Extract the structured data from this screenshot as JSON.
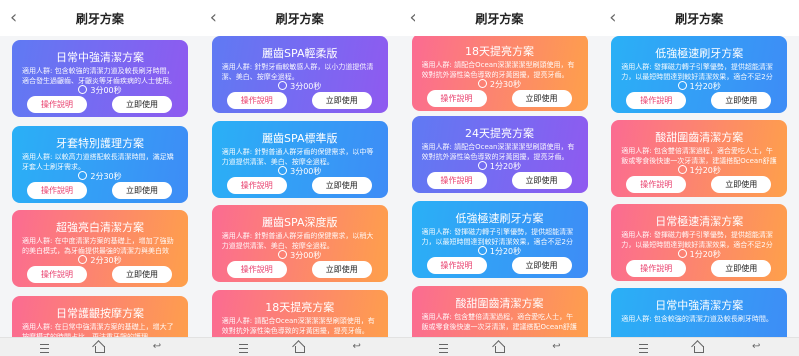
{
  "app": {
    "title": "刷牙方案",
    "back_symbol": "‹"
  },
  "labels": {
    "info_button": "操作說明",
    "use_button": "立即使用"
  },
  "colors": {
    "gradient_purple": [
      "#5f7af3",
      "#8f5af0"
    ],
    "gradient_blue": [
      "#2ab0f6",
      "#3e8cf6"
    ],
    "gradient_orange": [
      "#fb6b92",
      "#fea04a"
    ],
    "info_text": "#e83b6a"
  },
  "icons": {
    "header_back": "back-arrow-icon",
    "duration": "clock-icon",
    "nav_menu": "menu-icon",
    "nav_home": "home-icon",
    "nav_back": "back-icon"
  },
  "screens": [
    {
      "cards": [
        {
          "style": "purple",
          "title": "日常中強清潔方案",
          "desc": "適用人群: 包含較強的清潔力道及較長刷牙時間，適合發生過齦齒、牙齦炎等牙齒疾病的人士使用。",
          "duration": "3分00秒"
        },
        {
          "style": "blue",
          "title": "牙套特別護理方案",
          "desc": "適用人群: 以較高力道搭配較長清潔時間，滿足矯牙套人士刷牙需求。",
          "duration": "2分30秒"
        },
        {
          "style": "orange",
          "title": "超強亮白清潔方案",
          "desc": "適用人群: 在中度清潔方案的基礎上，增加了強勁的美白模式，為牙齒提供最強的清潔力與美白效果。",
          "duration": "2分30秒"
        },
        {
          "style": "orange",
          "title": "日常護齦按摩方案",
          "desc": "適用人群: 在日常中強清潔方案的基礎上，增大了按摩模式的時間占比，更注重牙齦的護理。",
          "duration": ""
        }
      ]
    },
    {
      "cards": [
        {
          "style": "purple",
          "title": "麗齒SPA輕柔版",
          "desc": "適用人群: 針對牙齒較敏感人群，以小力道提供清潔、美白、按摩全過程。",
          "duration": "3分00秒"
        },
        {
          "style": "blue",
          "title": "麗齒SPA標準版",
          "desc": "適用人群: 針對普通人群牙齒的保健需求，以中等力道提供清潔、美白、按摩全過程。",
          "duration": "3分00秒"
        },
        {
          "style": "orange",
          "title": "麗齒SPA深度版",
          "desc": "適用人群: 針對普通人群牙齒的保健需求，以稍大力道提供清潔、美白、按摩全過程。",
          "duration": "3分00秒"
        },
        {
          "style": "orange",
          "title": "18天提亮方案",
          "desc": "適用人群: 請配合Ocean深潔潔潔型刷頭使用，有效對抗外源性染色導致的牙黃困擾，提亮牙齒。",
          "duration": ""
        }
      ]
    },
    {
      "cards": [
        {
          "style": "orange",
          "title": "18天提亮方案",
          "desc": "適用人群: 請配合Ocean深潔潔潔型刷頭使用，有效對抗外源性染色導致的牙黃困擾，提亮牙齒。",
          "duration": "2分30秒"
        },
        {
          "style": "purple",
          "title": "24天提亮方案",
          "desc": "適用人群: 請配合Ocean深潔潔潔型刷頭使用，有效對抗外源性染色導致的牙黃困擾，提亮牙齒。",
          "duration": "1分20秒"
        },
        {
          "style": "blue",
          "title": "低強極速刷牙方案",
          "desc": "適用人群: 發揮磁力轉子引擎優勢，提供超能清潔力，以最短時間達到較好清潔效果，適合不足2分鐘時長的用戶。",
          "duration": "1分20秒"
        },
        {
          "style": "orange",
          "title": "酸甜圍齒清潔方案",
          "desc": "適用人群: 包含雙倍清潔過程，適合愛吃人士，午飯或零食後快速一次牙清潔，建議搭配Ocean舒護型刷頭使用。",
          "duration": ""
        }
      ]
    },
    {
      "cards": [
        {
          "style": "blue",
          "title": "低強極速刷牙方案",
          "desc": "適用人群: 發揮磁力轉子引擎優勢，提供超能清潔力，以最短時間達到較好清潔效果，適合不足2分鐘時長的用戶。",
          "duration": "1分20秒"
        },
        {
          "style": "orange",
          "title": "酸甜圍齒清潔方案",
          "desc": "適用人群: 包含雙倍清潔過程，適合愛吃人士，午飯或零食後快速一次牙清潔，建議搭配Ocean舒護型刷頭使用。",
          "duration": "1分20秒"
        },
        {
          "style": "orange",
          "title": "日常極速清潔方案",
          "desc": "適用人群: 發揮磁力轉子引擎優勢，提供超能清潔力，以最短時間達到較好清潔效果，適合不足2分鐘時長的用戶。",
          "duration": "1分20秒"
        },
        {
          "style": "blue",
          "title": "日常中強清潔方案",
          "desc": "適用人群: 包含較強的清潔力道及較長刷牙時間。",
          "duration": ""
        }
      ]
    }
  ]
}
